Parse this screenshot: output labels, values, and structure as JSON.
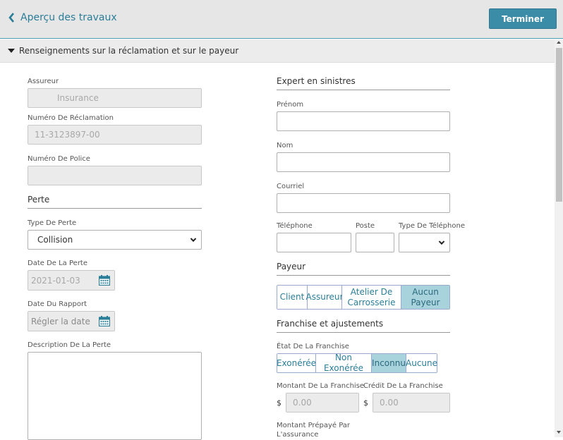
{
  "topbar": {
    "back_label": "Aperçu des travaux",
    "finish_label": "Terminer"
  },
  "section": {
    "title": "Renseignements sur la réclamation et sur le payeur"
  },
  "left": {
    "insurer": {
      "label": "Assureur",
      "value": "Insurance"
    },
    "claim_number": {
      "label": "Numéro De Réclamation",
      "value": "11-3123897-00"
    },
    "policy_number": {
      "label": "Numéro De Police",
      "value": ""
    },
    "loss_header": "Perte",
    "loss_type": {
      "label": "Type De Perte",
      "value": "Collision"
    },
    "loss_date": {
      "label": "Date De La Perte",
      "value": "2021-01-03"
    },
    "report_date": {
      "label": "Date Du Rapport",
      "placeholder": "Régler la date"
    },
    "loss_description": {
      "label": "Description De La Perte",
      "value": ""
    }
  },
  "right": {
    "adjuster_header": "Expert en sinistres",
    "first_name": {
      "label": "Prénom",
      "value": ""
    },
    "last_name": {
      "label": "Nom",
      "value": ""
    },
    "email": {
      "label": "Courriel",
      "value": ""
    },
    "phone": {
      "label": "Téléphone",
      "value": ""
    },
    "extension": {
      "label": "Poste",
      "value": ""
    },
    "phone_type": {
      "label": "Type De Téléphone",
      "value": ""
    },
    "payer_header": "Payeur",
    "payer_options": [
      "Client",
      "Assureur",
      "Atelier De Carrosserie",
      "Aucun Payeur"
    ],
    "payer_selected": "Aucun Payeur",
    "deductible_header": "Franchise et ajustements",
    "deductible_state": {
      "label": "État De La Franchise",
      "options": [
        "Exonérée",
        "Non Exonérée",
        "Inconnu",
        "Aucune"
      ],
      "selected": "Inconnu"
    },
    "deductible_amount": {
      "label": "Montant De La Franchise",
      "currency": "$",
      "placeholder": "0.00"
    },
    "deductible_credit": {
      "label": "Crédit De La Franchise",
      "currency": "$",
      "placeholder": "0.00"
    },
    "prepaid": {
      "label_line1": "Montant Prépayé Par",
      "label_line2": "L'assurance"
    }
  },
  "colors": {
    "accent": "#3b8ca6",
    "link": "#2b7e98",
    "active_segment": "#a8d2dc"
  }
}
